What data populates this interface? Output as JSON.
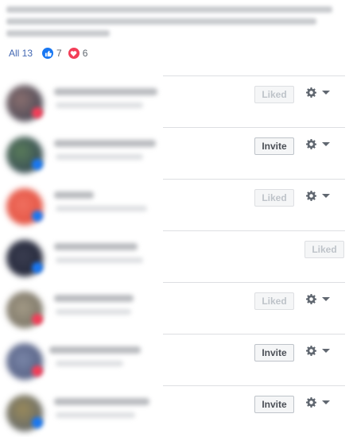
{
  "tabs": {
    "all_label": "All 13",
    "like_count": "7",
    "love_count": "6"
  },
  "rows": [
    {
      "action": "Liked",
      "type": "liked",
      "show_menu": true
    },
    {
      "action": "Invite",
      "type": "invite",
      "show_menu": true
    },
    {
      "action": "Liked",
      "type": "liked",
      "show_menu": true
    },
    {
      "action": "Liked",
      "type": "liked",
      "show_menu": false
    },
    {
      "action": "Liked",
      "type": "liked",
      "show_menu": true
    },
    {
      "action": "Invite",
      "type": "invite",
      "show_menu": true
    },
    {
      "action": "Invite",
      "type": "invite",
      "show_menu": true
    }
  ],
  "colors": {
    "link_blue": "#4267b2",
    "like_blue": "#1877f2",
    "love_red": "#f33e58"
  },
  "icons": [
    "like-reaction-icon",
    "love-reaction-icon",
    "gear-icon",
    "caret-down-icon"
  ]
}
